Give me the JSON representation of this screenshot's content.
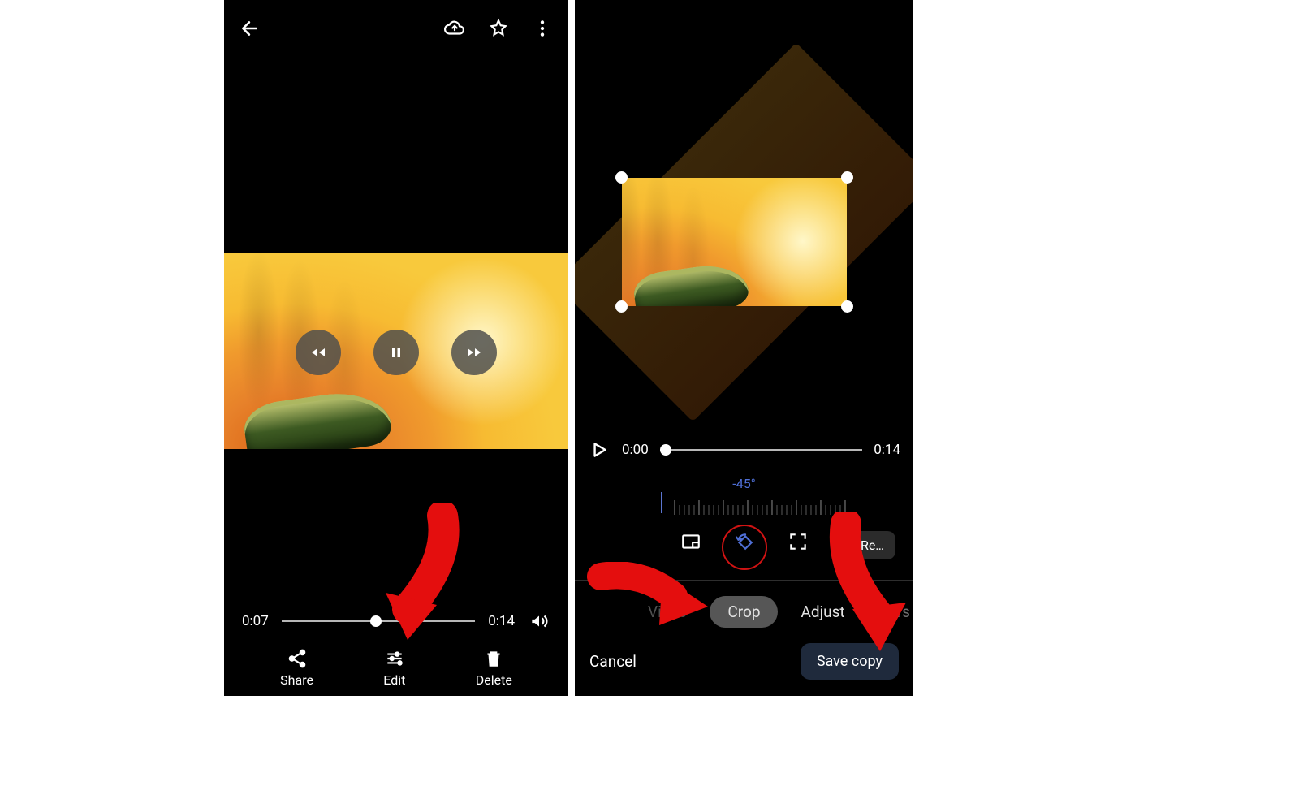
{
  "viewer": {
    "current_time": "0:07",
    "total_time": "0:14",
    "actions": {
      "share": "Share",
      "edit": "Edit",
      "delete": "Delete"
    }
  },
  "editor": {
    "current_time": "0:00",
    "total_time": "0:14",
    "rotation_angle": "-45°",
    "reset_label": "Re…",
    "tabs": {
      "video": "Video",
      "crop": "Crop",
      "adjust": "Adjust",
      "filters": "Filters"
    },
    "cancel": "Cancel",
    "save": "Save copy"
  }
}
